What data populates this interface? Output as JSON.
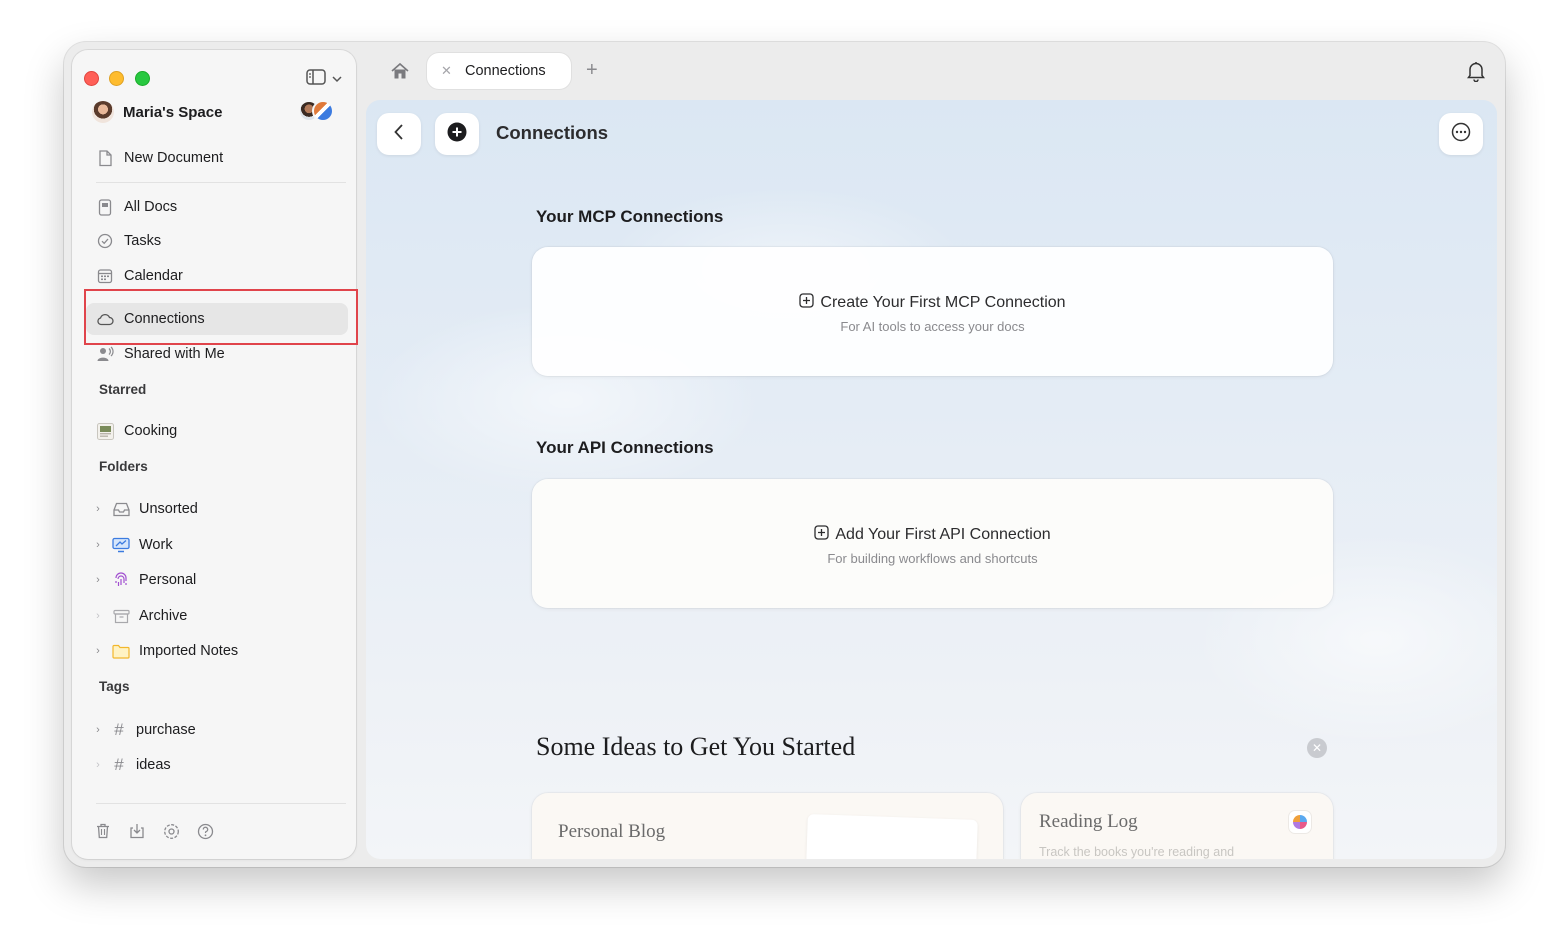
{
  "sidebar": {
    "space_name": "Maria's Space",
    "new_document": "New Document",
    "nav": [
      "All Docs",
      "Tasks",
      "Calendar",
      "Connections",
      "Shared with Me"
    ],
    "starred_heading": "Starred",
    "starred": [
      "Cooking"
    ],
    "folders_heading": "Folders",
    "folders": [
      "Unsorted",
      "Work",
      "Personal",
      "Archive",
      "Imported Notes"
    ],
    "tags_heading": "Tags",
    "tags": [
      "purchase",
      "ideas"
    ]
  },
  "tabs": {
    "active_label": "Connections"
  },
  "main": {
    "title": "Connections",
    "mcp": {
      "heading": "Your MCP Connections",
      "cta": "Create Your First MCP Connection",
      "sub": "For AI tools to access your docs"
    },
    "api": {
      "heading": "Your API Connections",
      "cta": "Add Your First API Connection",
      "sub": "For building workflows and shortcuts"
    },
    "ideas": {
      "heading": "Some Ideas to Get You Started",
      "cards": [
        {
          "title": "Personal Blog"
        },
        {
          "title": "Reading Log",
          "sub": "Track the books you're reading and"
        }
      ]
    }
  },
  "colors": {
    "highlight": "#e0444b",
    "active_item_bg": "#e6e6e6",
    "accent_blue": "#3b7be0"
  }
}
